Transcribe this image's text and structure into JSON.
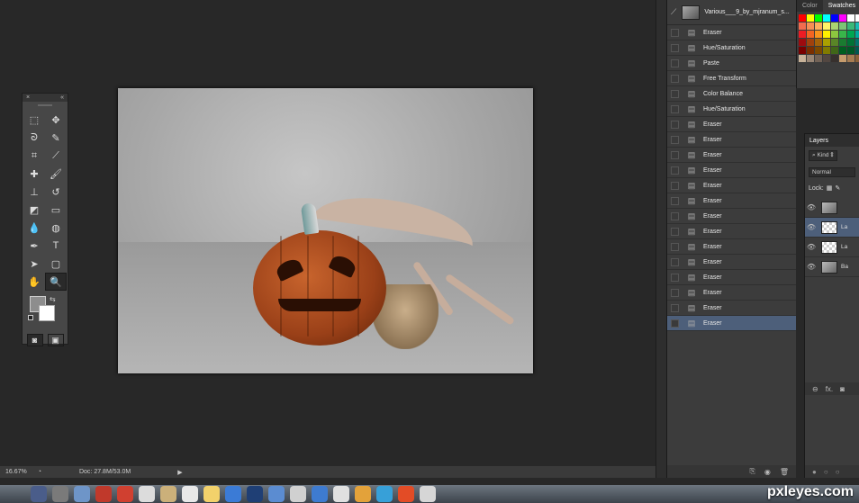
{
  "status_bar": {
    "zoom": "16.67%",
    "doc": "Doc: 27.8M/53.0M"
  },
  "toolbox": {
    "close": "×",
    "collapse": "«",
    "tools": [
      {
        "name": "marquee-tool-icon",
        "glyph": "⬚"
      },
      {
        "name": "move-tool-icon",
        "glyph": "✥"
      },
      {
        "name": "lasso-tool-icon",
        "glyph": "ᘐ"
      },
      {
        "name": "quick-select-tool-icon",
        "glyph": "✎"
      },
      {
        "name": "crop-tool-icon",
        "glyph": "⌗"
      },
      {
        "name": "eyedropper-tool-icon",
        "glyph": "⟋"
      },
      {
        "name": "healing-brush-tool-icon",
        "glyph": "✚"
      },
      {
        "name": "brush-tool-icon",
        "glyph": "🖌"
      },
      {
        "name": "stamp-tool-icon",
        "glyph": "⊥"
      },
      {
        "name": "history-brush-tool-icon",
        "glyph": "↺"
      },
      {
        "name": "eraser-tool-icon",
        "glyph": "◩"
      },
      {
        "name": "gradient-tool-icon",
        "glyph": "▭"
      },
      {
        "name": "blur-tool-icon",
        "glyph": "💧"
      },
      {
        "name": "dodge-tool-icon",
        "glyph": "◍"
      },
      {
        "name": "pen-tool-icon",
        "glyph": "✒"
      },
      {
        "name": "type-tool-icon",
        "glyph": "T"
      },
      {
        "name": "path-select-tool-icon",
        "glyph": "➤"
      },
      {
        "name": "shape-tool-icon",
        "glyph": "▢"
      },
      {
        "name": "hand-tool-icon",
        "glyph": "✋"
      },
      {
        "name": "zoom-tool-icon",
        "glyph": "🔍"
      }
    ],
    "active_tool": 19
  },
  "history": {
    "source": "Various___9_by_mjranum_s...",
    "items": [
      "Eraser",
      "Hue/Saturation",
      "Paste",
      "Free Transform",
      "Color Balance",
      "Hue/Saturation",
      "Eraser",
      "Eraser",
      "Eraser",
      "Eraser",
      "Eraser",
      "Eraser",
      "Eraser",
      "Eraser",
      "Eraser",
      "Eraser",
      "Eraser",
      "Eraser",
      "Eraser",
      "Eraser"
    ],
    "selected_index": 19
  },
  "color_panel": {
    "tab_color": "Color",
    "tab_swatches": "Swatches",
    "swatches": [
      "#ff0000",
      "#ffff00",
      "#00ff00",
      "#00ffff",
      "#0000ff",
      "#ff00ff",
      "#ffffff",
      "#ffffff",
      "#f26c4f",
      "#f68e55",
      "#fbaf5c",
      "#fff467",
      "#acd372",
      "#7cc576",
      "#3bb878",
      "#1abbb4",
      "#ed1c24",
      "#f26522",
      "#f7941d",
      "#fff200",
      "#8dc73f",
      "#39b54a",
      "#00a651",
      "#00a99d",
      "#9e0b0f",
      "#a0410d",
      "#a36209",
      "#aba000",
      "#598527",
      "#1a7b30",
      "#007236",
      "#00746b",
      "#790000",
      "#7b2e00",
      "#7d4900",
      "#827b00",
      "#406618",
      "#005e20",
      "#005826",
      "#005952",
      "#c7b299",
      "#998675",
      "#736357",
      "#534741",
      "#37302d",
      "#c69c6d",
      "#a67c52",
      "#8c6239"
    ]
  },
  "layers": {
    "tab": "Layers",
    "kind_label": "Kind",
    "blend_mode": "Normal",
    "lock_label": "Lock:",
    "items": [
      {
        "name": "",
        "thumb": "img"
      },
      {
        "name": "La",
        "thumb": "trans"
      },
      {
        "name": "La",
        "thumb": "trans"
      },
      {
        "name": "Ba",
        "thumb": "img"
      }
    ],
    "selected_index": 1
  },
  "watermark": "pxleyes.com",
  "dock_colors": [
    "#4a5d8a",
    "#7a7a7a",
    "#6e95c8",
    "#c0392b",
    "#d04030",
    "#dcdcdc",
    "#cbb07a",
    "#e8e8e8",
    "#f2d16b",
    "#3b7bd6",
    "#1f3f75",
    "#5b8cd1",
    "#d0d0d0",
    "#3e7bd0",
    "#e0e0e0",
    "#e3a23a",
    "#37a0d8",
    "#e34c26",
    "#d6d6d6"
  ]
}
